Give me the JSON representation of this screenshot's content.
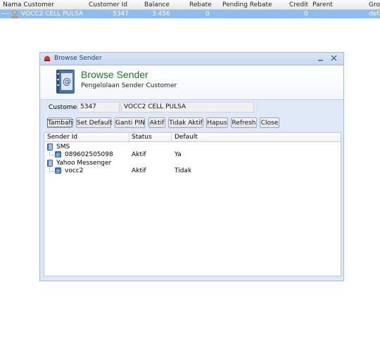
{
  "background": {
    "columns": [
      "Nama Customer",
      "Customer Id",
      "Balance",
      "Rebate",
      "Pending Rebate",
      "Credit",
      "Parent",
      "Grou"
    ],
    "row": {
      "nama": "VOCC2 CELL PULSA",
      "customer_id": "5347",
      "balance": "3.456",
      "rebate": "0",
      "credit": "0",
      "group": "defa"
    }
  },
  "window": {
    "title": "Browse Sender",
    "banner_title": "Browse Sender",
    "banner_subtitle": "Pengelolaan Sender Customer"
  },
  "customer": {
    "label": "Customer",
    "id": "5347",
    "name": "VOCC2 CELL PULSA"
  },
  "toolbar": {
    "tambah": "Tambah",
    "set_default": "Set Default",
    "ganti_pin": "Ganti PIN",
    "aktif": "Aktif",
    "tidak_aktif": "Tidak Aktif",
    "hapus": "Hapus",
    "refresh": "Refresh",
    "close": "Close"
  },
  "grid": {
    "columns": [
      "Sender Id",
      "Status",
      "Default"
    ],
    "groups": [
      {
        "name": "SMS",
        "rows": [
          {
            "sender": "089602505098",
            "status": "Aktif",
            "default": "Ya"
          }
        ]
      },
      {
        "name": "Yahoo Messenger",
        "rows": [
          {
            "sender": "vocc2",
            "status": "Aktif",
            "default": "Tidak"
          }
        ]
      }
    ]
  },
  "colors": {
    "selection": "#8bbdf0",
    "window_bg": "#dfe8f6",
    "title_text": "#15428b",
    "banner_title": "#1d7a1d"
  }
}
